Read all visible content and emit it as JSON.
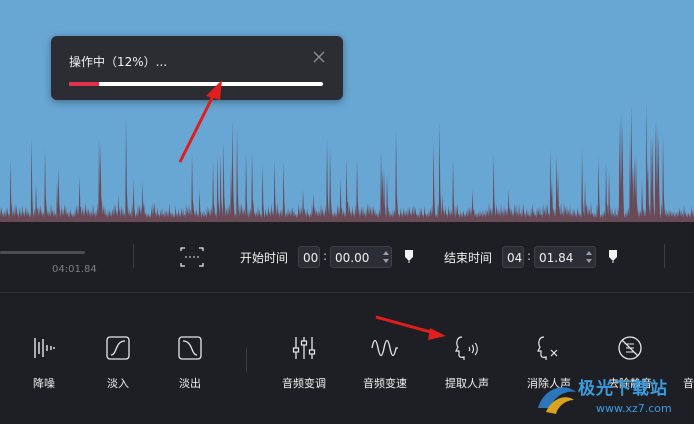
{
  "waveform": {
    "bg_color": "#68a6d4",
    "peak_color": "#6a4a56"
  },
  "dialog": {
    "title": "操作中（12%）...",
    "progress": 0.12,
    "progress_color": "#e0304d"
  },
  "timeline": {
    "duration": "04:01.84",
    "start_label": "开始时间",
    "start_min": "00",
    "start_sec": "00.00",
    "end_label": "结束时间",
    "end_min": "04",
    "end_sec": "01.84"
  },
  "tools": [
    {
      "label": "降噪",
      "icon": "denoise-icon"
    },
    {
      "label": "淡入",
      "icon": "fade-in-icon"
    },
    {
      "label": "淡出",
      "icon": "fade-out-icon"
    },
    {
      "label": "音频变调",
      "icon": "pitch-sliders-icon"
    },
    {
      "label": "音频变速",
      "icon": "speed-wave-icon"
    },
    {
      "label": "提取人声",
      "icon": "extract-voice-icon"
    },
    {
      "label": "消除人声",
      "icon": "remove-voice-icon"
    },
    {
      "label": "去除静音",
      "icon": "remove-silence-icon"
    },
    {
      "label": "音",
      "icon": "more-icon"
    }
  ],
  "watermark": {
    "text": "极光下载站",
    "url": "www.xz7.com"
  }
}
